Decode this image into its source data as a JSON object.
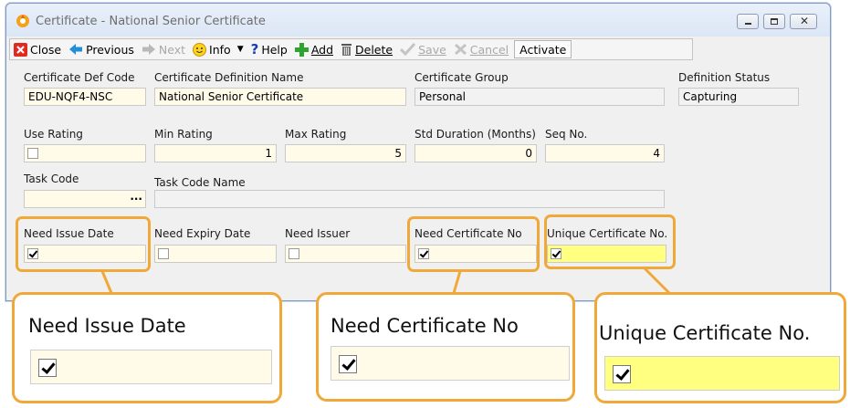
{
  "window": {
    "title": "Certificate - National Senior Certificate"
  },
  "toolbar": {
    "close": "Close",
    "previous": "Previous",
    "next": "Next",
    "info": "Info",
    "help": "Help",
    "add": "Add",
    "delete": "Delete",
    "save": "Save",
    "cancel": "Cancel",
    "activate": "Activate"
  },
  "form": {
    "cert_def_code": {
      "label": "Certificate Def Code",
      "value": "EDU-NQF4-NSC"
    },
    "cert_def_name": {
      "label": "Certificate Definition Name",
      "value": "National Senior Certificate"
    },
    "cert_group": {
      "label": "Certificate Group",
      "value": "Personal"
    },
    "def_status": {
      "label": "Definition Status",
      "value": "Capturing"
    },
    "use_rating": {
      "label": "Use Rating",
      "checked": false
    },
    "min_rating": {
      "label": "Min Rating",
      "value": "1"
    },
    "max_rating": {
      "label": "Max Rating",
      "value": "5"
    },
    "std_duration": {
      "label": "Std Duration (Months)",
      "value": "0"
    },
    "seq_no": {
      "label": "Seq No.",
      "value": "4"
    },
    "task_code": {
      "label": "Task Code",
      "value": "",
      "lookup": "..."
    },
    "task_code_name": {
      "label": "Task Code Name",
      "value": ""
    },
    "need_issue_date": {
      "label": "Need Issue Date",
      "checked": true
    },
    "need_expiry_date": {
      "label": "Need Expiry Date",
      "checked": false
    },
    "need_issuer": {
      "label": "Need Issuer",
      "checked": false
    },
    "need_cert_no": {
      "label": "Need Certificate No",
      "checked": true
    },
    "unique_cert_no": {
      "label": "Unique Certificate No.",
      "checked": true
    }
  },
  "callouts": {
    "issue_date": "Need Issue Date",
    "cert_no": "Need Certificate No",
    "unique": "Unique Certificate No."
  },
  "colors": {
    "highlight": "#f0a938",
    "field_bg": "#fffbe8",
    "unique_bg": "#ffff80"
  }
}
